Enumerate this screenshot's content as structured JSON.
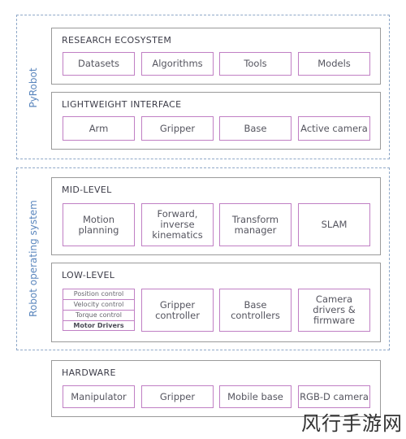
{
  "groups": {
    "pyrobot": {
      "label": "PyRobot"
    },
    "ros": {
      "label": "Robot operating system"
    }
  },
  "layers": {
    "research": {
      "title": "RESEARCH ECOSYSTEM",
      "items": [
        "Datasets",
        "Algorithms",
        "Tools",
        "Models"
      ]
    },
    "lightweight": {
      "title": "LIGHTWEIGHT INTERFACE",
      "items": [
        "Arm",
        "Gripper",
        "Base",
        "Active camera"
      ]
    },
    "mid": {
      "title": "MID-LEVEL",
      "items": [
        "Motion\nplanning",
        "Forward,\ninverse\nkinematics",
        "Transform\nmanager",
        "SLAM"
      ]
    },
    "low": {
      "title": "LOW-LEVEL",
      "stack": [
        "Position control",
        "Velocity control",
        "Torque control",
        "Motor Drivers"
      ],
      "items": [
        "Gripper\ncontroller",
        "Base\ncontrollers",
        "Camera\ndrivers &\nfirmware"
      ]
    },
    "hardware": {
      "title": "HARDWARE",
      "items": [
        "Manipulator",
        "Gripper",
        "Mobile base",
        "RGB-D camera"
      ]
    }
  },
  "watermark": "风行手游网",
  "colors": {
    "group_border": "#8fa8c8",
    "group_label": "#5a86bd",
    "layer_border": "#9a9a9a",
    "cell_border": "#c07fc4"
  }
}
